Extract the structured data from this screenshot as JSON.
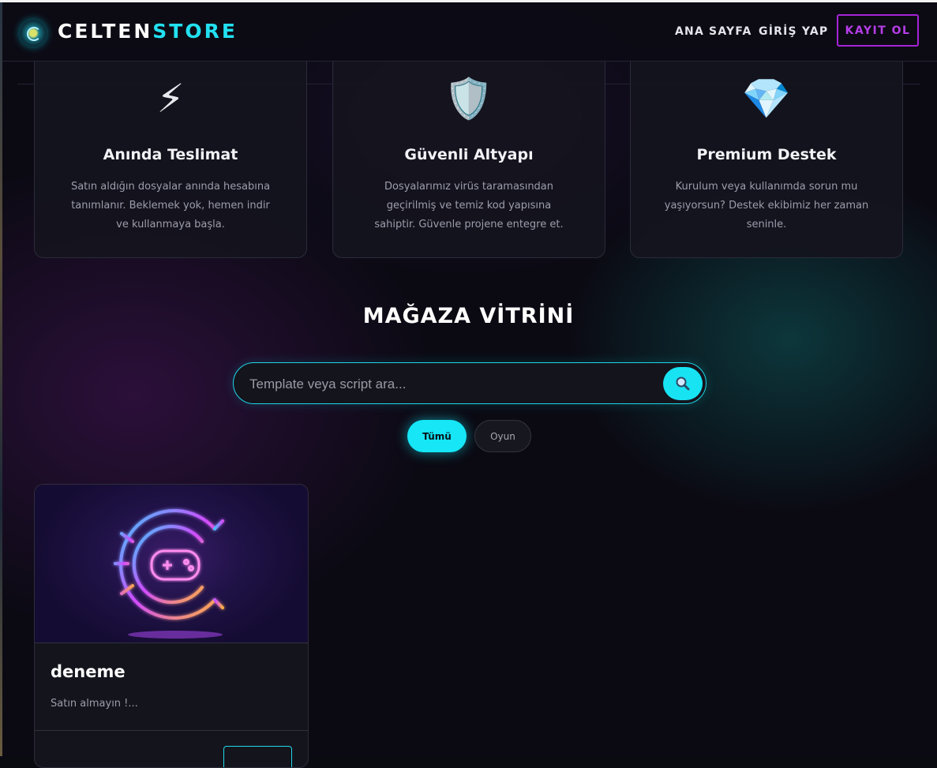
{
  "brand": {
    "part1": "CELTEN",
    "part2": "STORE",
    "logo_icon": "globe-logo-icon"
  },
  "nav": {
    "home": "ANA SAYFA",
    "login": "GİRİŞ YAP",
    "register": "KAYIT OL"
  },
  "features": [
    {
      "icon": "⚡",
      "icon_name": "lightning-icon",
      "title": "Anında Teslimat",
      "desc": "Satın aldığın dosyalar anında hesabına tanımlanır. Beklemek yok, hemen indir ve kullanmaya başla."
    },
    {
      "icon": "🛡️",
      "icon_name": "shield-icon",
      "title": "Güvenli Altyapı",
      "desc": "Dosyalarımız virüs taramasından geçirilmiş ve temiz kod yapısına sahiptir. Güvenle projene entegre et."
    },
    {
      "icon": "💎",
      "icon_name": "diamond-icon",
      "title": "Premium Destek",
      "desc": "Kurulum veya kullanımda sorun mu yaşıyorsun? Destek ekibimiz her zaman seninle."
    }
  ],
  "showcase": {
    "title": "MAĞAZA VİTRİNİ"
  },
  "search": {
    "placeholder": "Template veya script ara...",
    "value": "",
    "button_icon": "search-icon"
  },
  "filters": [
    {
      "label": "Tümü",
      "active": true
    },
    {
      "label": "Oyun",
      "active": false
    }
  ],
  "products": [
    {
      "name": "deneme",
      "desc": "Satın almayın !..."
    }
  ],
  "colors": {
    "accent_cyan": "#16e6f6",
    "accent_purple": "#a623d6",
    "background": "#0b0a13"
  }
}
